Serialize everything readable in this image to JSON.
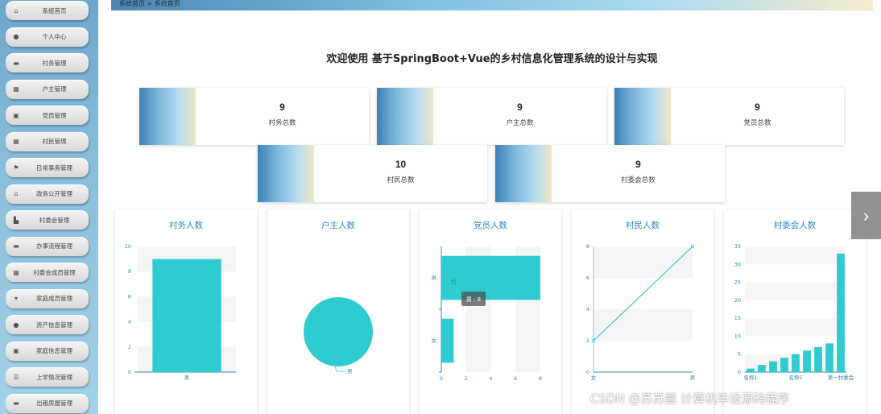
{
  "breadcrumb": {
    "home": "系统首页",
    "sep": ">",
    "current": "系统首页"
  },
  "title": "欢迎使用 基于SpringBoot+Vue的乡村信息化管理系统的设计与实现",
  "sidebar": {
    "items": [
      {
        "label": "系统首页",
        "icon": "home-icon"
      },
      {
        "label": "个人中心",
        "icon": "user-icon"
      },
      {
        "label": "村务管理",
        "icon": "list-icon"
      },
      {
        "label": "户主管理",
        "icon": "grid-icon"
      },
      {
        "label": "党员管理",
        "icon": "doc-icon"
      },
      {
        "label": "村民管理",
        "icon": "grid-icon"
      },
      {
        "label": "日常事务管理",
        "icon": "flag-icon"
      },
      {
        "label": "政务公开管理",
        "icon": "bank-icon"
      },
      {
        "label": "村委会管理",
        "icon": "chart-icon"
      },
      {
        "label": "办事流程管理",
        "icon": "list-icon"
      },
      {
        "label": "村委会成员管理",
        "icon": "grid-icon"
      },
      {
        "label": "家庭成员管理",
        "icon": "funnel-icon"
      },
      {
        "label": "资产信息管理",
        "icon": "pin-icon"
      },
      {
        "label": "家庭信息管理",
        "icon": "doc-icon"
      },
      {
        "label": "上学情况管理",
        "icon": "menu-icon"
      },
      {
        "label": "出租房屋管理",
        "icon": "monitor-icon"
      }
    ]
  },
  "stats": [
    {
      "value": "9",
      "label": "村务总数"
    },
    {
      "value": "9",
      "label": "户主总数"
    },
    {
      "value": "9",
      "label": "党员总数"
    },
    {
      "value": "10",
      "label": "村民总数"
    },
    {
      "value": "9",
      "label": "村委会总数"
    }
  ],
  "colors": {
    "accent": "#2f86c0",
    "series": "#2ecbd1"
  },
  "tooltip": "男 : 8",
  "watermark": "CSDN @苏苏酱    计算机毕设源码程序",
  "chart_data": [
    {
      "type": "bar",
      "title": "村务人数",
      "categories": [
        "男"
      ],
      "values": [
        9
      ],
      "ylim": [
        0,
        10
      ],
      "yticks": [
        0,
        2,
        4,
        6,
        8,
        10
      ]
    },
    {
      "type": "pie",
      "title": "户主人数",
      "slices": [
        {
          "name": "男",
          "value": 9
        }
      ]
    },
    {
      "type": "bar",
      "orientation": "horizontal",
      "title": "党员人数",
      "categories": [
        "女",
        "男"
      ],
      "values": [
        1,
        8
      ],
      "xlim": [
        0,
        8
      ],
      "xticks": [
        0,
        2,
        4,
        6,
        8
      ]
    },
    {
      "type": "line",
      "title": "村民人数",
      "categories": [
        "女",
        "男"
      ],
      "values": [
        2,
        8
      ],
      "ylim": [
        0,
        8
      ],
      "yticks": [
        0,
        2,
        4,
        6,
        8
      ]
    },
    {
      "type": "bar",
      "title": "村委会人数",
      "categories": [
        "名称1",
        "名称2",
        "名称3",
        "名称4",
        "名称5",
        "名称6",
        "名称7",
        "名称8",
        "第一村委会"
      ],
      "tick_labels": [
        "名称1",
        "名称5",
        "第一村委会"
      ],
      "values": [
        1,
        2,
        3,
        4,
        5,
        6,
        7,
        8,
        33
      ],
      "ylim": [
        0,
        35
      ],
      "yticks": [
        0,
        5,
        10,
        15,
        20,
        25,
        30,
        35
      ]
    }
  ]
}
